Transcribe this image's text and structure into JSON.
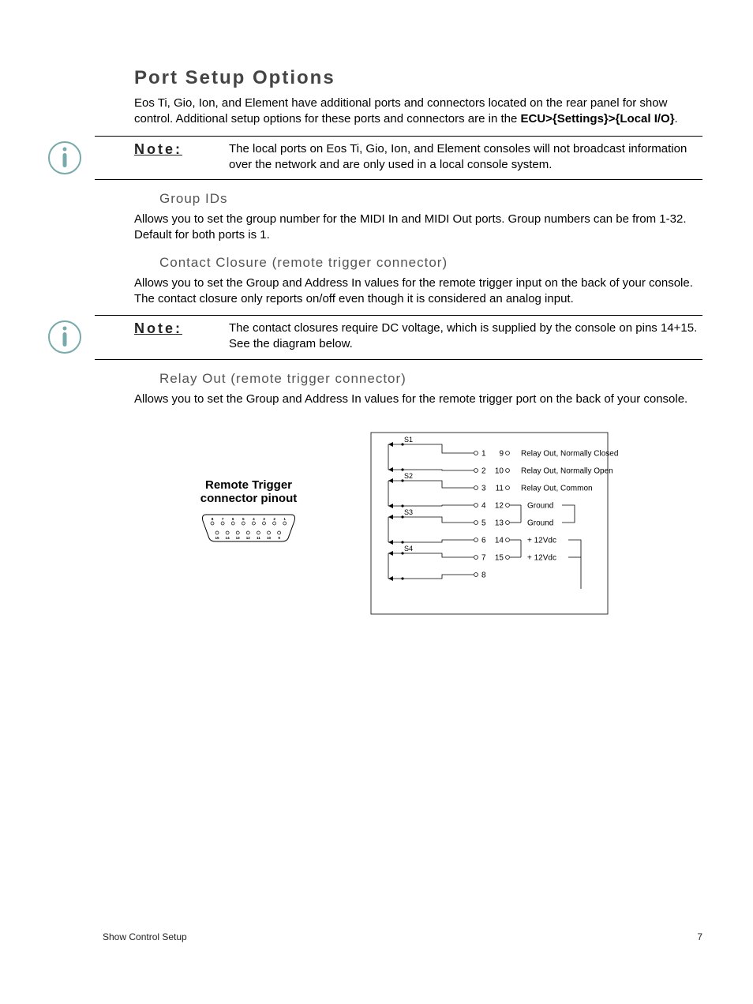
{
  "section_title": "Port Setup Options",
  "intro_line1": "Eos Ti, Gio, Ion, and Element have additional ports and connectors located on the rear panel for show control. Additional setup options for these ports and connectors are in the ",
  "intro_path": "ECU>{Settings}>{Local I/O}",
  "intro_period": ".",
  "note1_label": "Note:",
  "note1_text": "The local ports on Eos Ti, Gio, Ion, and Element consoles will not broadcast information over the network and are only used in a local console system.",
  "group_ids_heading": "Group IDs",
  "group_ids_text": "Allows you to set the group number for the MIDI In and MIDI Out ports. Group numbers can be from 1-32. Default for both ports is 1.",
  "contact_closure_heading": "Contact Closure (remote trigger connector)",
  "contact_closure_text": "Allows you to set the Group and Address In values for the remote trigger input on the back of your console. The contact closure only reports on/off even though it is considered an analog input.",
  "note2_label": "Note:",
  "note2_text": "The contact closures require DC voltage, which is supplied by the console on pins 14+15. See the diagram below.",
  "relay_out_heading": "Relay Out (remote trigger connector)",
  "relay_out_text": "Allows you to set the Group and Address In values for the remote trigger port on the back of your console.",
  "pinout_label_l1": "Remote Trigger",
  "pinout_label_l2": "connector pinout",
  "db15_top_pins": [
    "8",
    "7",
    "6",
    "5",
    "4",
    "3",
    "2",
    "1"
  ],
  "db15_bottom_pins": [
    "15",
    "14",
    "13",
    "12",
    "11",
    "10",
    "9"
  ],
  "switches": [
    "S1",
    "S2",
    "S3",
    "S4"
  ],
  "left_pins": [
    "1",
    "2",
    "3",
    "4",
    "5",
    "6",
    "7",
    "8"
  ],
  "right_pins": [
    {
      "n": "9",
      "label": "Relay Out, Normally Closed"
    },
    {
      "n": "10",
      "label": "Relay Out, Normally Open"
    },
    {
      "n": "11",
      "label": "Relay Out, Common"
    },
    {
      "n": "12",
      "label": "Ground"
    },
    {
      "n": "13",
      "label": "Ground"
    },
    {
      "n": "14",
      "label": "+ 12Vdc"
    },
    {
      "n": "15",
      "label": "+ 12Vdc"
    }
  ],
  "footer_left": "Show Control Setup",
  "footer_right": "7"
}
